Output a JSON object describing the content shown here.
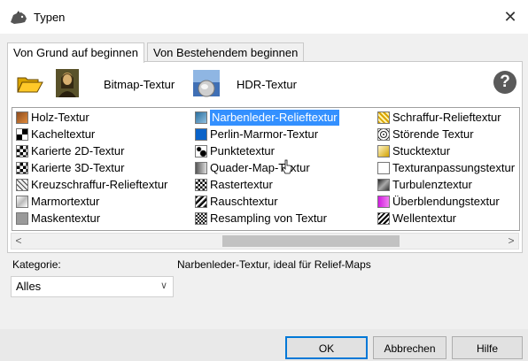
{
  "window": {
    "title": "Typen",
    "close_glyph": "✕",
    "icon": "rhino-icon"
  },
  "tabs": [
    {
      "label": "Von Grund auf beginnen",
      "active": true
    },
    {
      "label": "Von Bestehendem beginnen",
      "active": false
    }
  ],
  "toolbar": {
    "folder_icon": "folder-open-icon",
    "bitmap_icon": "mona-lisa-icon",
    "bitmap_label": "Bitmap-Textur",
    "hdr_icon": "hdr-globe-icon",
    "hdr_label": "HDR-Textur",
    "help_icon": "help-icon",
    "help_glyph": "?"
  },
  "textures": {
    "col1": [
      "Holz-Textur",
      "Kacheltextur",
      "Karierte 2D-Textur",
      "Karierte 3D-Textur",
      "Kreuzschraffur-Relieftextur",
      "Marmortextur",
      "Maskentextur"
    ],
    "col2": [
      "Narbenleder-Relieftextur",
      "Perlin-Marmor-Textur",
      "Punktetextur",
      "Quader-Map-Textur",
      "Rastertextur",
      "Rauschtextur",
      "Resampling von Textur"
    ],
    "col3": [
      "Schraffur-Relieftextur",
      "Störende Textur",
      "Stucktextur",
      "Texturanpassungstextur",
      "Turbulenztextur",
      "Überblendungstextur",
      "Wellentextur"
    ],
    "selected": "Narbenleder-Relieftextur"
  },
  "scroll": {
    "left_arrow": "<",
    "right_arrow": ">"
  },
  "category": {
    "label": "Kategorie:",
    "value": "Alles",
    "chevron": "∨"
  },
  "description": "Narbenleder-Textur, ideal für Relief-Maps",
  "buttons": {
    "ok": "OK",
    "cancel": "Abbrechen",
    "help": "Hilfe"
  },
  "colors": {
    "accent": "#0078d7",
    "selection": "#3390ff"
  }
}
